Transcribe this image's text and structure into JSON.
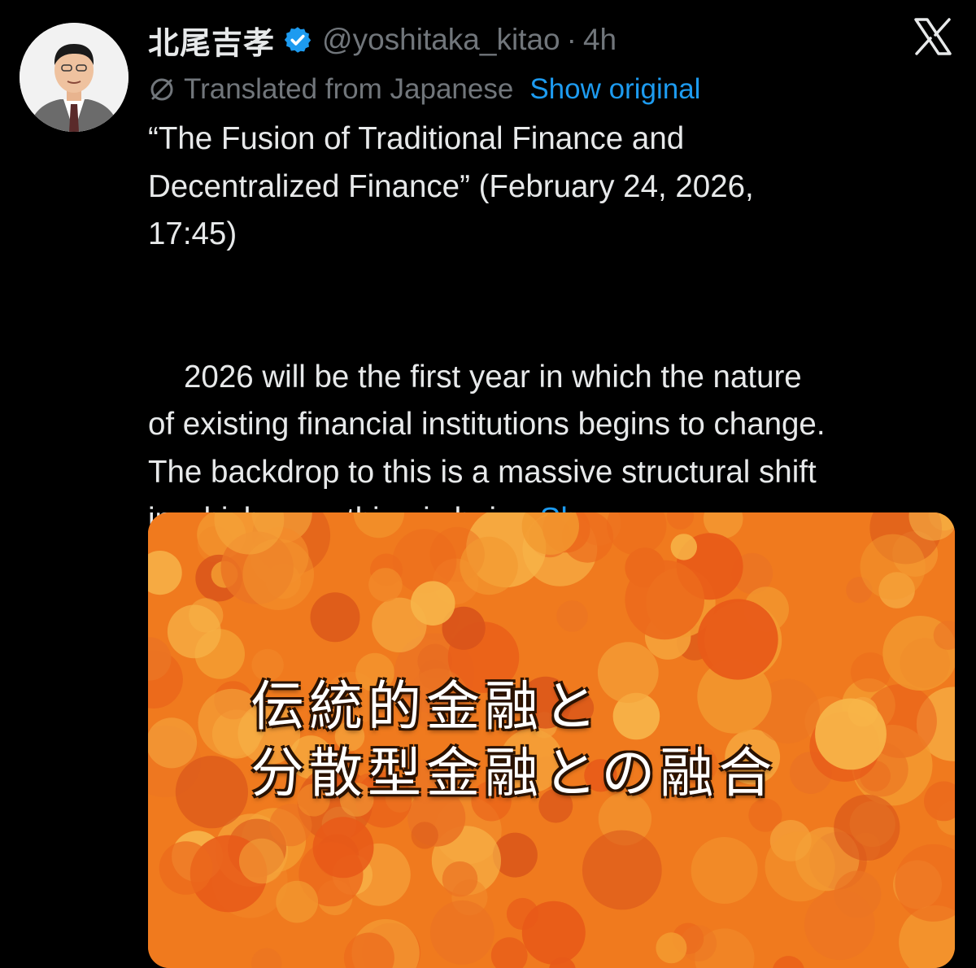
{
  "author": {
    "display_name": "北尾吉孝",
    "handle": "@yoshitaka_kitao",
    "separator": "·",
    "timestamp": "4h",
    "verified_icon": "verified-badge-icon",
    "verified_color": "#1d9bf0"
  },
  "translation": {
    "icon": "globe-icon",
    "label": "Translated from Japanese",
    "show_original": "Show original"
  },
  "tweet": {
    "line1": "“The Fusion of Traditional Finance and",
    "line2": "Decentralized Finance” (February 24, 2026,",
    "line3": "17:45)",
    "body_line1": "2026 will be the first year in which the nature",
    "body_line2": "of existing financial institutions begins to change.",
    "body_line3": "The backdrop to this is a massive structural shift",
    "body_line4": "in which everything is being",
    "show_more": "Show more"
  },
  "media": {
    "title_line1": "伝統的金融と",
    "title_line2": "分散型金融との融合"
  },
  "colors": {
    "background": "#000000",
    "text": "#e7e9ea",
    "muted": "#71767b",
    "link": "#1d9bf0",
    "media_orange": "#f07a1e"
  },
  "icons": {
    "platform_logo": "x-logo-icon"
  }
}
